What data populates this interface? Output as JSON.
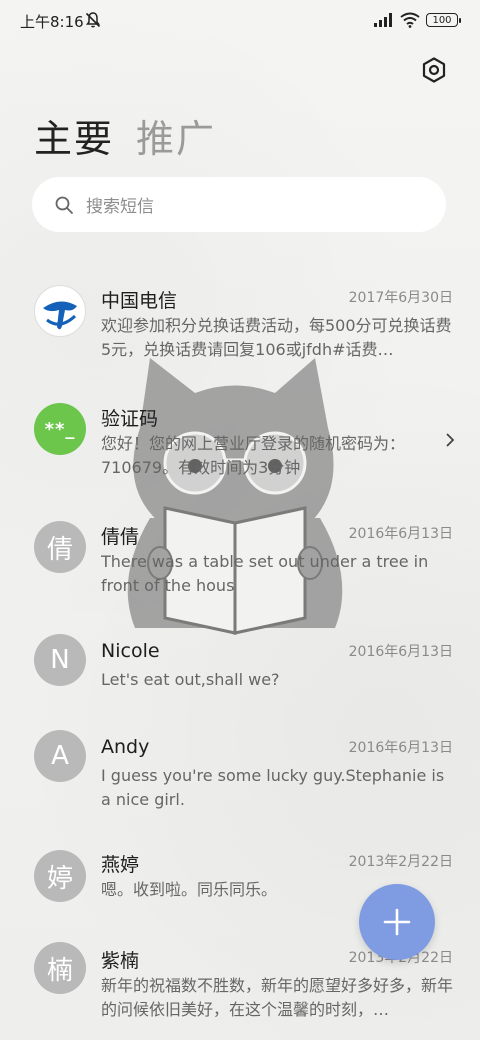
{
  "status_bar": {
    "time": "上午8:16",
    "battery": "100",
    "icons": [
      "mute-icon",
      "signal-icon",
      "wifi-icon",
      "battery-icon"
    ]
  },
  "header": {
    "settings_icon": "gear-icon",
    "tabs": [
      {
        "label": "主要",
        "active": true
      },
      {
        "label": "推广",
        "active": false
      }
    ]
  },
  "search": {
    "placeholder": "搜索短信",
    "icon": "search-icon"
  },
  "conversations": [
    {
      "avatar": "",
      "avatar_type": "telecom-logo",
      "name": "中国电信",
      "date": "2017年6月30日",
      "preview": "欢迎参加积分兑换话费活动，每500分可兑换话费5元，兑换话费请回复106或jfdh#话费…"
    },
    {
      "avatar": "**_",
      "avatar_type": "code",
      "name": "验证码",
      "date": "",
      "preview": "您好！您的网上营业厅登录的随机密码为：710679。有效时间为3分钟"
    },
    {
      "avatar": "倩",
      "avatar_type": "letter",
      "name": "倩倩",
      "date": "2016年6月13日",
      "preview": "There was a table set out under a tree in front of the hous"
    },
    {
      "avatar": "N",
      "avatar_type": "letter",
      "name": "Nicole",
      "date": "2016年6月13日",
      "preview": "Let's eat out,shall we?"
    },
    {
      "avatar": "A",
      "avatar_type": "letter",
      "name": "Andy",
      "date": "2016年6月13日",
      "preview": "I guess you're some lucky guy.Stephanie is a nice girl."
    },
    {
      "avatar": "婷",
      "avatar_type": "letter",
      "name": "燕婷",
      "date": "2013年2月22日",
      "preview": "嗯。收到啦。同乐同乐。"
    },
    {
      "avatar": "楠",
      "avatar_type": "letter",
      "name": "紫楠",
      "date": "2013年2月22日",
      "preview": "新年的祝福数不胜数，新年的愿望好多好多，新年的问候依旧美好，在这个温馨的时刻，…"
    }
  ],
  "fab": {
    "icon": "plus-icon"
  },
  "colors": {
    "accent": "#7f9be2",
    "avatar_gray": "#b9b9b9",
    "code_green": "#6cc64b",
    "telecom_blue": "#1560b8"
  }
}
